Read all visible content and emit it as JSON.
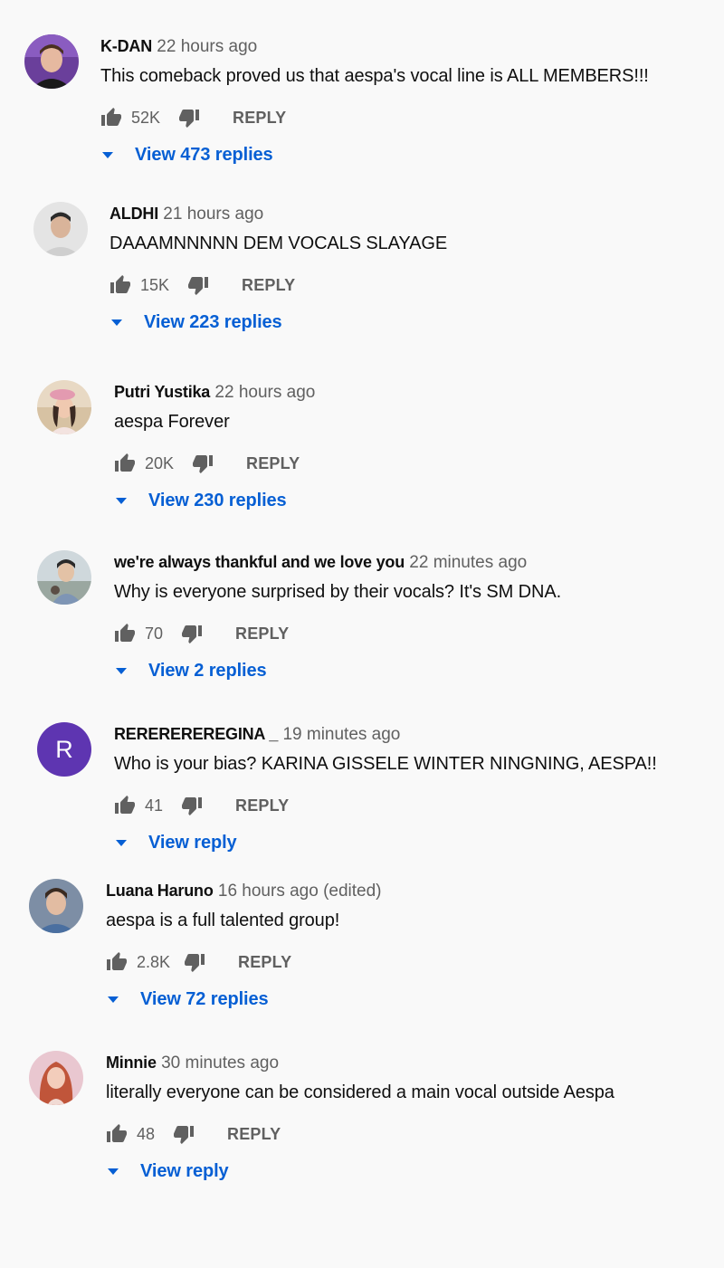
{
  "comments": [
    {
      "author": "K-DAN",
      "time": "22 hours ago",
      "text": "This comeback proved us that aespa's vocal line is ALL MEMBERS!!!",
      "likes": "52K",
      "reply_label": "REPLY",
      "replies_label": "View 473 replies",
      "avatar_icon": "avatar-man-dark-shirt"
    },
    {
      "author": "ALDHI",
      "time": "21 hours ago",
      "text": "DAAAMNNNNN DEM VOCALS SLAYAGE",
      "likes": "15K",
      "reply_label": "REPLY",
      "replies_label": "View 223 replies",
      "avatar_icon": "avatar-man-light"
    },
    {
      "author": "Putri Yustika",
      "time": "22 hours ago",
      "text": "aespa Forever",
      "likes": "20K",
      "reply_label": "REPLY",
      "replies_label": "View 230 replies",
      "avatar_icon": "avatar-woman-pink-hat"
    },
    {
      "author": "we're always thankful and we love you",
      "time": "22 minutes ago",
      "text": "Why is everyone surprised by their vocals? It's SM DNA.",
      "likes": "70",
      "reply_label": "REPLY",
      "replies_label": "View 2 replies",
      "avatar_icon": "avatar-person-outdoor"
    },
    {
      "author": "REREREREREGINA _",
      "time": "19 minutes ago",
      "text": "Who is your bias? KARINA GISSELE WINTER NINGNING, AESPA!!",
      "likes": "41",
      "reply_label": "REPLY",
      "replies_label": "View reply",
      "avatar_letter": "R",
      "avatar_color": "#5e35b1"
    },
    {
      "author": "Luana Haruno",
      "time": "16 hours ago (edited)",
      "text": "aespa is a full talented group!",
      "likes": "2.8K",
      "reply_label": "REPLY",
      "replies_label": "View 72 replies",
      "avatar_icon": "avatar-man-blue"
    },
    {
      "author": "Minnie",
      "time": "30 minutes ago",
      "text": "literally everyone can be considered a main vocal outside Aespa",
      "likes": "48",
      "reply_label": "REPLY",
      "replies_label": "View reply",
      "avatar_icon": "avatar-woman-red-hair"
    }
  ],
  "colors": {
    "background": "#f9f9f9",
    "link": "#065fd4",
    "secondary_text": "#606060",
    "icon": "#606060"
  }
}
